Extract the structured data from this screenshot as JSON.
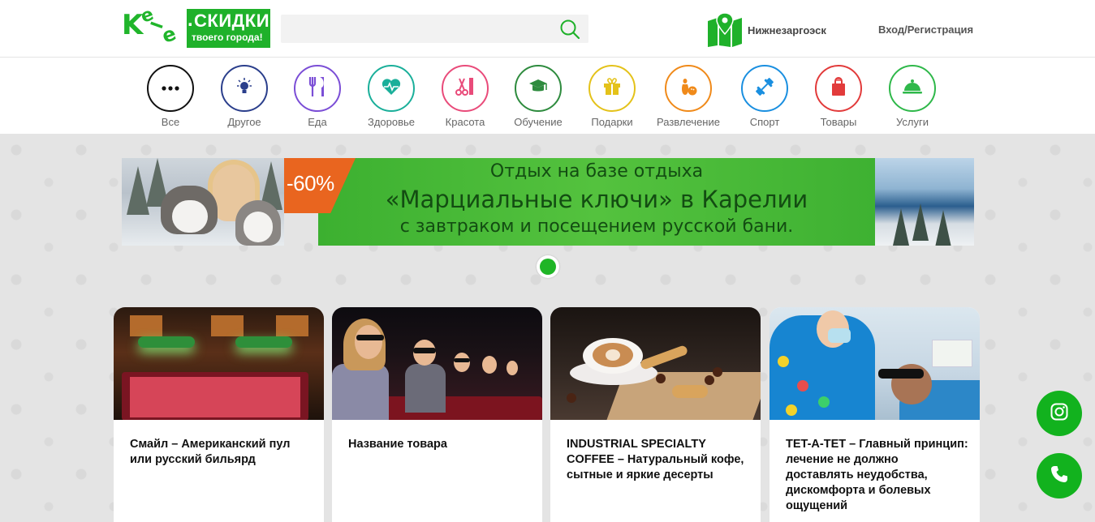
{
  "logo": {
    "brand": "Kele",
    "line1": "СКИДКИ",
    "line2": "твоего города!"
  },
  "search": {
    "placeholder": "",
    "value": ""
  },
  "location": {
    "city": "Нижнезаргоэск"
  },
  "auth": {
    "label": "Вход/Регистрация"
  },
  "categories": [
    {
      "label": "Все",
      "color": "#111111",
      "icon": "dots-icon"
    },
    {
      "label": "Другое",
      "color": "#2b3f8c",
      "icon": "lightbulb-icon"
    },
    {
      "label": "Еда",
      "color": "#7b4ed6",
      "icon": "fork-knife-icon"
    },
    {
      "label": "Здоровье",
      "color": "#1aaf9a",
      "icon": "heart-pulse-icon"
    },
    {
      "label": "Красота",
      "color": "#e94b7a",
      "icon": "scissors-comb-icon"
    },
    {
      "label": "Обучение",
      "color": "#2e8b3e",
      "icon": "graduation-cap-icon"
    },
    {
      "label": "Подарки",
      "color": "#e4c21a",
      "icon": "gift-icon"
    },
    {
      "label": "Развлечение",
      "color": "#f08a1a",
      "icon": "bowling-icon"
    },
    {
      "label": "Спорт",
      "color": "#1a8fe0",
      "icon": "dumbbell-icon"
    },
    {
      "label": "Товары",
      "color": "#e23b3b",
      "icon": "shopping-bag-icon"
    },
    {
      "label": "Услуги",
      "color": "#2fb84a",
      "icon": "service-cloche-icon"
    }
  ],
  "banner": {
    "discount": "-60%",
    "line1": "Отдых на базе отдыха",
    "line2": "«Марциальные ключи» в Карелии",
    "line3": "с завтраком и посещением русской бани."
  },
  "cards": [
    {
      "title": "Смайл – Американский пул или русский бильярд",
      "image": "billiard"
    },
    {
      "title": "Название товара",
      "image": "cinema"
    },
    {
      "title": "INDUSTRIAL SPECIALTY COFFEE – Натуральный кофе, сытные и яркие десерты",
      "image": "coffee"
    },
    {
      "title": "TET-A-TET – Главный принцип: лечение не должно доставлять неудобства, дискомфорта и болевых ощущений",
      "image": "dentist"
    }
  ],
  "floating": {
    "instagram": "instagram-icon",
    "phone": "phone-icon"
  },
  "colors": {
    "brand_green": "#1fb12a",
    "fab_green": "#12b21e"
  }
}
